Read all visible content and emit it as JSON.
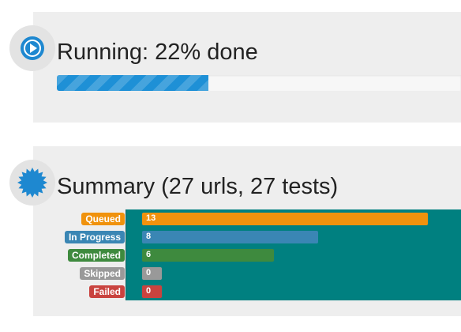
{
  "running": {
    "title": "Running: 22% done",
    "progress_fraction": 0.375,
    "progress_color": "#1e90d6",
    "icon": "play-circle-icon"
  },
  "summary": {
    "title": "Summary (27 urls, 27 tests)",
    "icon": "badge-star-icon",
    "chart_background": "#008080"
  },
  "chart_data": {
    "type": "bar",
    "orientation": "horizontal",
    "categories": [
      "Queued",
      "In Progress",
      "Completed",
      "Skipped",
      "Failed"
    ],
    "values": [
      13,
      8,
      6,
      0,
      0
    ],
    "colors": [
      "#f0920d",
      "#3a86b4",
      "#3e8a3e",
      "#999999",
      "#c9433f"
    ],
    "xlim": [
      0,
      14.5
    ]
  }
}
